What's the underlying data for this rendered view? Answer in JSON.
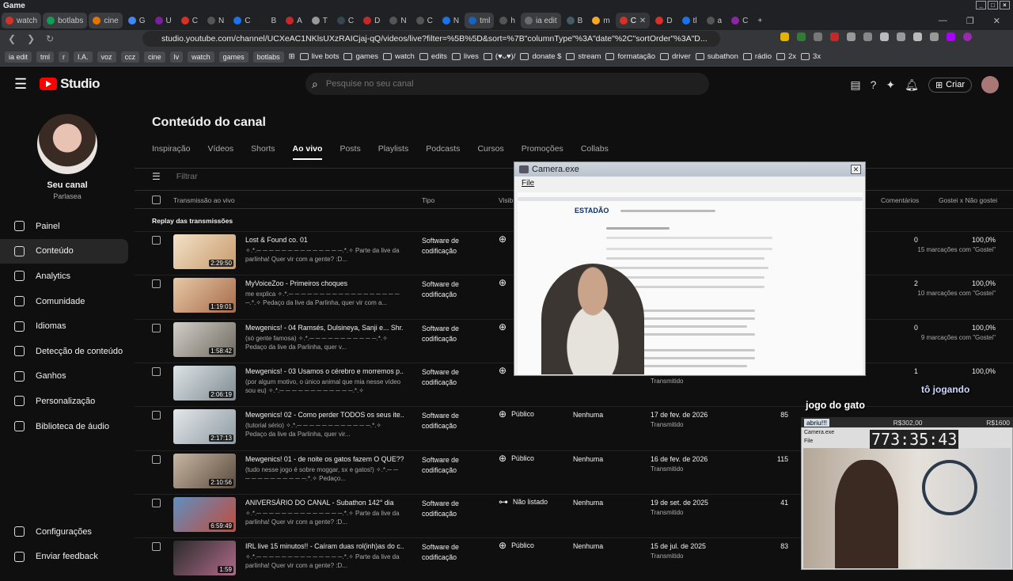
{
  "window": {
    "title": "Game"
  },
  "tabs": [
    {
      "label": "watch",
      "color": "#d93025",
      "named": true
    },
    {
      "label": "botlabs",
      "color": "#0f9d58",
      "named": true
    },
    {
      "label": "cine",
      "color": "#e37400",
      "named": true
    },
    {
      "label": "G",
      "color": "#4285f4"
    },
    {
      "label": "U",
      "color": "#7b1fa2"
    },
    {
      "label": "C",
      "color": "#d93025"
    },
    {
      "label": "N",
      "color": "#555555"
    },
    {
      "label": "C",
      "color": "#1a73e8"
    },
    {
      "label": "B",
      "color": "#222222"
    },
    {
      "label": "A",
      "color": "#c62828"
    },
    {
      "label": "T",
      "color": "#999999"
    },
    {
      "label": "C",
      "color": "#37474f"
    },
    {
      "label": "D",
      "color": "#c62828"
    },
    {
      "label": "N",
      "color": "#555555"
    },
    {
      "label": "C",
      "color": "#555555"
    },
    {
      "label": "N",
      "color": "#1a73e8"
    },
    {
      "label": "tml",
      "color": "#1565c0",
      "named": true
    },
    {
      "label": "h",
      "color": "#555555"
    },
    {
      "label": "ia edit",
      "color": "#6d6d6d",
      "named": true
    },
    {
      "label": "B",
      "color": "#455a64"
    },
    {
      "label": "m",
      "color": "#f9a825"
    },
    {
      "label": "C",
      "color": "#d93025",
      "active": true
    },
    {
      "label": "D",
      "color": "#d93025"
    },
    {
      "label": "tl",
      "color": "#1a73e8"
    },
    {
      "label": "a",
      "color": "#555555"
    },
    {
      "label": "C",
      "color": "#8e24aa"
    }
  ],
  "address": {
    "url": "studio.youtube.com/channel/UCXeAC1NKlsUXzRAICjaj-qQ/videos/live?filter=%5B%5D&sort=%7B\"columnType\"%3A\"date\"%2C\"sortOrder\"%3A\"D..."
  },
  "bookmarks": {
    "chips": [
      "ia edit",
      "tml",
      "r",
      "I.A.",
      "voz",
      "ccz",
      "cine",
      "lv",
      "watch",
      "games",
      "botlabs"
    ],
    "folders": [
      "live bots",
      "games",
      "watch",
      "edits",
      "lives",
      "(♥ᴗ♥)/",
      "donate $",
      "stream",
      "formatação",
      "driver",
      "subathon",
      "rádio",
      "2x",
      "3x"
    ]
  },
  "header": {
    "brand": "Studio",
    "search_placeholder": "Pesquise no seu canal",
    "create_label": "Criar"
  },
  "sidebar": {
    "channel_name": "Seu canal",
    "channel_sub": "Parlasea",
    "items": [
      {
        "label": "Painel"
      },
      {
        "label": "Conteúdo",
        "active": true
      },
      {
        "label": "Analytics"
      },
      {
        "label": "Comunidade"
      },
      {
        "label": "Idiomas"
      },
      {
        "label": "Detecção de conteúdo"
      },
      {
        "label": "Ganhos"
      },
      {
        "label": "Personalização"
      },
      {
        "label": "Biblioteca de áudio"
      }
    ],
    "bottom": [
      {
        "label": "Configurações"
      },
      {
        "label": "Enviar feedback"
      }
    ]
  },
  "main": {
    "title": "Conteúdo do canal",
    "tabs": [
      "Inspiração",
      "Vídeos",
      "Shorts",
      "Ao vivo",
      "Posts",
      "Playlists",
      "Podcasts",
      "Cursos",
      "Promoções",
      "Collabs"
    ],
    "active_tab": "Ao vivo",
    "filter_placeholder": "Filtrar",
    "columns": {
      "stream": "Transmissão ao vivo",
      "type": "Tipo",
      "visibility": "Visib",
      "comments": "Comentários",
      "likes": "Gostei x Não gostei"
    },
    "section_label": "Replay das transmissões",
    "rows": [
      {
        "title": "Lost & Found co. 01",
        "desc": "✧.*.─ ─ ─ ─ ─ ─ ─ ─ ─ ─ ─ ─ ─ ─.*.✧ Parte da live da parlinha! Quer vir com a gente? :D...",
        "duration": "2:29:50",
        "type": "Software de codificação",
        "visibility": "",
        "restrictions": "",
        "date": "",
        "date_sub": "",
        "views": "",
        "comments": "0",
        "likes": "100,0%",
        "likes_sub": "15 marcações com \"Gostei\""
      },
      {
        "title": "MyVoiceZoo - Primeiros choques",
        "desc": "me explica ✧.*.─ ─ ─ ─ ─ ─ ─ ─ ─ ─ ─ ─ ─ ─ ─ ─ ─ ─ ─.*.✧ Pedaço da live da Parlinha, quer vir com a...",
        "duration": "1:19:01",
        "type": "Software de codificação",
        "visibility": "",
        "restrictions": "",
        "date": "",
        "date_sub": "",
        "views": "",
        "comments": "2",
        "likes": "100,0%",
        "likes_sub": "10 marcações com \"Gostei\""
      },
      {
        "title": "Mewgenics! - 04 Ramsés, Dulsineya, Sanji e... Shr...",
        "desc": "(só gente famosa) ✧.*.─ ─ ─ ─ ─ ─ ─ ─ ─ ─ ─.*.✧ Pedaço da live da Parlinha, quer v...",
        "duration": "1:58:42",
        "type": "Software de codificação",
        "visibility": "",
        "restrictions": "",
        "date": "",
        "date_sub": "",
        "views": "",
        "comments": "0",
        "likes": "100,0%",
        "likes_sub": "9 marcações com \"Gostei\""
      },
      {
        "title": "Mewgenics! - 03 Usamos o cérebro e morremos p...",
        "desc": "(por algum motivo, o único animal que mia nesse vídeo sou eu) ✧.*.─ ─ ─ ─ ─ ─ ─ ─ ─ ─ ─ ─.*.✧",
        "duration": "2:06:19",
        "type": "Software de codificação",
        "visibility": "",
        "restrictions": "",
        "date": "",
        "date_sub": "Transmitido",
        "views": "",
        "comments": "1",
        "likes": "100,0%",
        "likes_sub": ""
      },
      {
        "title": "Mewgenics! 02 - Como perder TODOS os seus ite...",
        "desc": "(tutorial sério) ✧.*.─ ─ ─ ─ ─ ─ ─ ─ ─ ─ ─ ─.*.✧ Pedaço da live da Parlinha, quer vir...",
        "duration": "2:17:13",
        "type": "Software de codificação",
        "visibility": "Público",
        "restrictions": "Nenhuma",
        "date": "17 de fev. de 2026",
        "date_sub": "Transmitido",
        "views": "85",
        "comments": "",
        "likes": "",
        "likes_sub": ""
      },
      {
        "title": "Mewgenics! 01 - de noite os gatos fazem O QUE??!",
        "desc": "(tudo nesse jogo é sobre moggar, sx e gatos!) ✧.*.─ ─ ─ ─ ─ ─ ─ ─ ─ ─ ─ ─.*.✧ Pedaço...",
        "duration": "2:10:56",
        "type": "Software de codificação",
        "visibility": "Público",
        "restrictions": "Nenhuma",
        "date": "16 de fev. de 2026",
        "date_sub": "Transmitido",
        "views": "115",
        "comments": "",
        "likes": "",
        "likes_sub": ""
      },
      {
        "title": "ANIVERSÁRIO DO CANAL - Subathon 142° dia",
        "desc": "✧.*.─ ─ ─ ─ ─ ─ ─ ─ ─ ─ ─ ─ ─ ─.*.✧ Parte da live da parlinha! Quer vir com a gente? :D...",
        "duration": "6:59:49",
        "type": "Software de codificação",
        "visibility": "Não listado",
        "restrictions": "Nenhuma",
        "date": "19 de set. de 2025",
        "date_sub": "Transmitido",
        "views": "41",
        "comments": "",
        "likes": "",
        "likes_sub": ""
      },
      {
        "title": "IRL live 15 minutos!! - Caíram duas rol(inh)as do c...",
        "desc": "✧.*.─ ─ ─ ─ ─ ─ ─ ─ ─ ─ ─ ─ ─ ─.*.✧ Parte da live da parlinha! Quer vir com a gente? :D...",
        "duration": "1:59",
        "type": "Software de codificação",
        "visibility": "Público",
        "restrictions": "Nenhuma",
        "date": "15 de jul. de 2025",
        "date_sub": "Transmitido",
        "views": "83",
        "comments": "",
        "likes": "",
        "likes_sub": ""
      }
    ]
  },
  "camera_window": {
    "title": "Camera.exe",
    "menu": "File",
    "inner_brand": "ESTADÃO"
  },
  "overlay": {
    "playing": "tô jogando",
    "game": "jogo do gato",
    "tag": "abriu!!!",
    "money_a": "R$302,00",
    "money_b": "R$1600",
    "timer": "773:35:43",
    "cam2_title": "Camera.exe",
    "cam2_sub": "File"
  }
}
